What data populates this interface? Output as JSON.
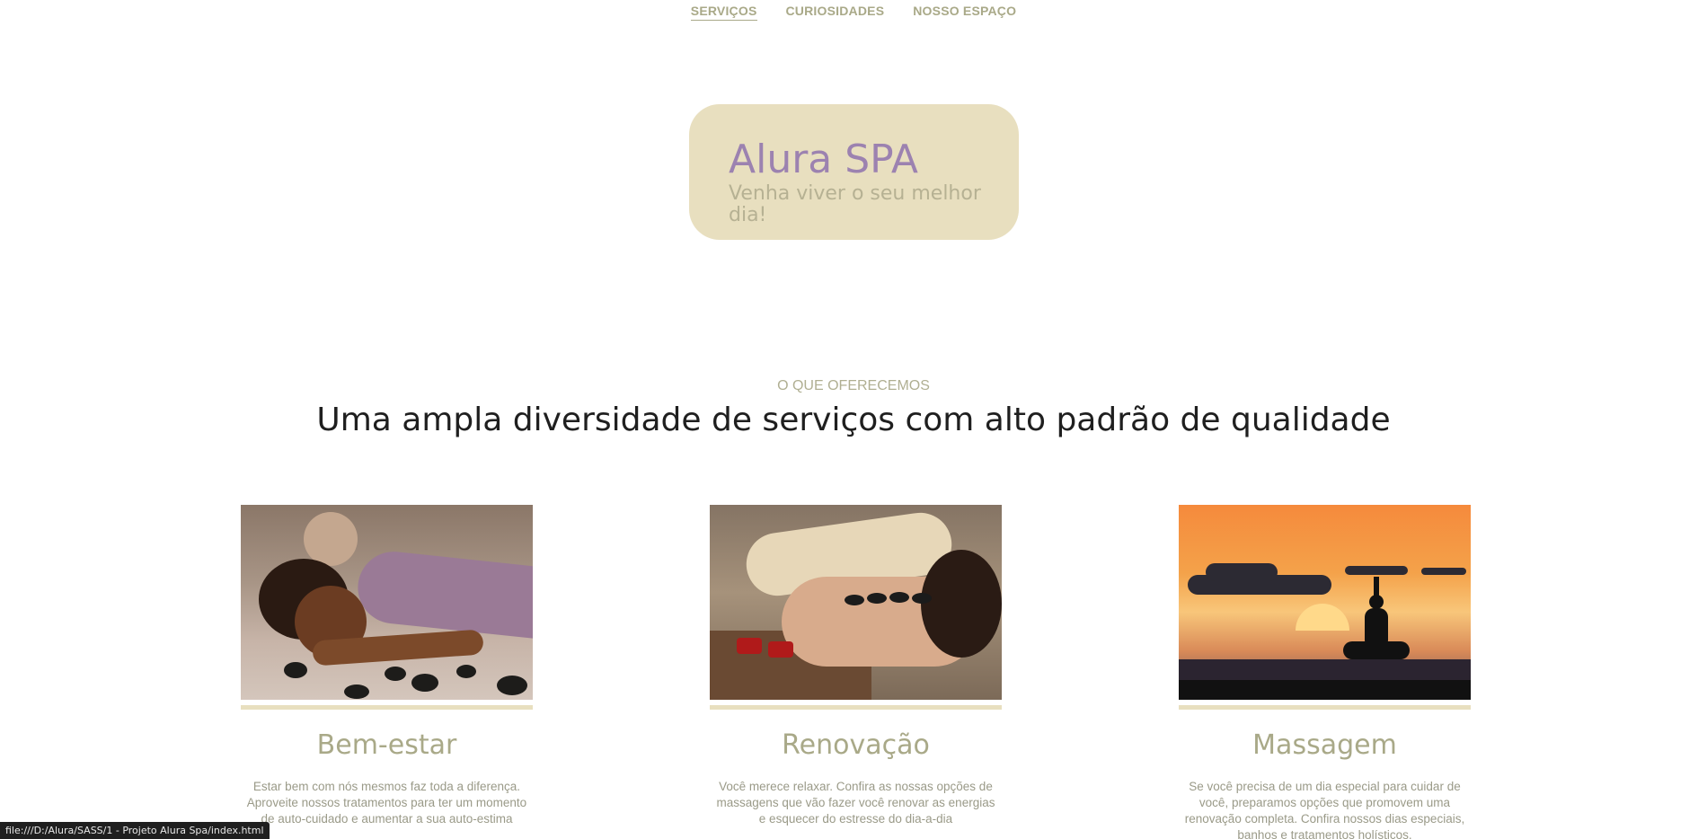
{
  "nav": {
    "items": [
      {
        "label": "SERVIÇOS",
        "active": true
      },
      {
        "label": "CURIOSIDADES",
        "active": false
      },
      {
        "label": "NOSSO ESPAÇO",
        "active": false
      }
    ]
  },
  "hero": {
    "title": "Alura SPA",
    "subtitle": "Venha viver o seu melhor dia!"
  },
  "services": {
    "kicker": "O QUE OFERECEMOS",
    "title": "Uma ampla diversidade de serviços com alto padrão de qualidade",
    "cards": [
      {
        "title": "Bem-estar",
        "text": "Estar bem com nós mesmos faz toda a diferença. Aproveite nossos tratamentos para ter um momento de auto-cuidado e aumentar a sua auto-estima"
      },
      {
        "title": "Renovação",
        "text": "Você merece relaxar. Confira as nossas opções de massagens que vão fazer você renovar as energias e esquecer do estresse do dia-a-dia"
      },
      {
        "title": "Massagem",
        "text": "Se você precisa de um dia especial para cuidar de você, preparamos opções que promovem uma renovação completa. Confira nossos dias especiais, banhos e tratamentos holísticos."
      }
    ]
  },
  "status_bar": {
    "url": "file:///D:/Alura/SASS/1 - Projeto Alura Spa/index.html"
  },
  "colors": {
    "accent_olive": "#a9a988",
    "hero_bg": "#e8dfbf",
    "hero_title": "#9c82b0"
  }
}
